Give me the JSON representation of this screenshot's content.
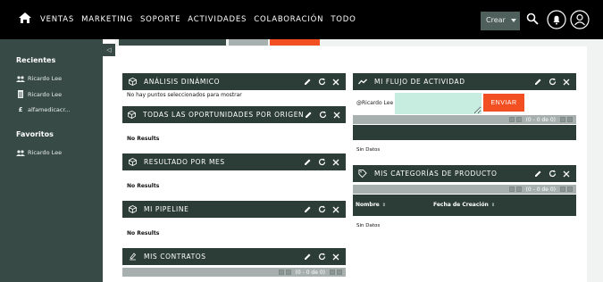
{
  "topnav": {
    "items": [
      "VENTAS",
      "MARKETING",
      "SOPORTE",
      "ACTIVIDADES",
      "COLABORACIÓN",
      "TODO"
    ],
    "create_label": "Crear"
  },
  "sidebar": {
    "recent_heading": "Recientes",
    "recent_items": [
      {
        "label": "Ricardo Lee",
        "icon": "contacts-icon"
      },
      {
        "label": "Ricardo Lee",
        "icon": "document-icon"
      },
      {
        "label": "alfamedicacr...",
        "icon": "pound-icon"
      }
    ],
    "favorites_heading": "Favoritos",
    "favorite_items": [
      {
        "label": "Ricardo Lee",
        "icon": "contacts-icon"
      }
    ],
    "toggle_glyph": "◁"
  },
  "dashlets": {
    "analisis": {
      "title": "ANÁLISIS DINÁMICO",
      "body": "No hay puntos seleccionados para mostrar"
    },
    "oportunidades": {
      "title": "TODAS LAS OPORTUNIDADES POR ORIGEN",
      "body": "No Results"
    },
    "resultado": {
      "title": "RESULTADO POR MES",
      "body": "No Results"
    },
    "pipeline": {
      "title": "MI PIPELINE",
      "body": "No Results"
    },
    "contratos": {
      "title": "MIS CONTRATOS",
      "pager": "(0 - 0 de 0)"
    },
    "actividad": {
      "title": "MI FLUJO DE ACTIVIDAD",
      "user": "@Ricardo Lee",
      "send_label": "ENVIAR",
      "pager": "(0 - 0 de 0)",
      "empty": "Sin Datos"
    },
    "categorias": {
      "title": "MIS CATEGORÍAS DE PRODUCTO",
      "pager": "(0 - 0 de 0)",
      "col_name": "Nombre",
      "col_date": "Fecha de Creación",
      "empty": "Sin Datos"
    }
  },
  "colors": {
    "nav_bg": "#000000",
    "sidebar_bg": "#374a45",
    "dashlet_header": "#2c3d38",
    "accent": "#f25022",
    "input_bg": "#c7ece0"
  }
}
